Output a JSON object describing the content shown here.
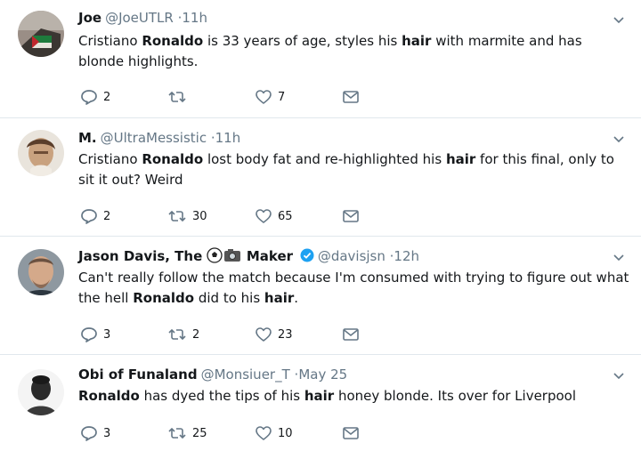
{
  "tweets": [
    {
      "name": "Joe",
      "handle": "@JoeUTLR",
      "time": "·11h",
      "text_parts": [
        {
          "t": "Cristiano ",
          "b": false
        },
        {
          "t": "Ronaldo",
          "b": true
        },
        {
          "t": " is 33 years of age, styles his ",
          "b": false
        },
        {
          "t": "hair",
          "b": true
        },
        {
          "t": " with marmite and has blonde highlights.",
          "b": false
        }
      ],
      "reply_count": "2",
      "retweet_count": "",
      "like_count": "7"
    },
    {
      "name": "M.",
      "handle": "@UltraMessistic",
      "time": "·11h",
      "text_parts": [
        {
          "t": "Cristiano ",
          "b": false
        },
        {
          "t": "Ronaldo",
          "b": true
        },
        {
          "t": " lost body fat and re-highlighted his ",
          "b": false
        },
        {
          "t": "hair",
          "b": true
        },
        {
          "t": " for this final, only to sit it out? Weird",
          "b": false
        }
      ],
      "reply_count": "2",
      "retweet_count": "30",
      "like_count": "65"
    },
    {
      "name": "Jason Davis, The",
      "name_suffix": "Maker",
      "handle": "@davisjsn",
      "time": "·12h",
      "text_parts": [
        {
          "t": "Can't really follow the match because I'm consumed with trying to figure out what the hell ",
          "b": false
        },
        {
          "t": "Ronaldo",
          "b": true
        },
        {
          "t": " did to his ",
          "b": false
        },
        {
          "t": "hair",
          "b": true
        },
        {
          "t": ".",
          "b": false
        }
      ],
      "reply_count": "3",
      "retweet_count": "2",
      "like_count": "23"
    },
    {
      "name": "Obi of Funaland",
      "handle": "@Monsiuer_T",
      "time": "·May 25",
      "text_parts": [
        {
          "t": "Ronaldo",
          "b": true
        },
        {
          "t": " has dyed the tips of his ",
          "b": false
        },
        {
          "t": "hair",
          "b": true
        },
        {
          "t": " honey blonde. Its over for Liverpool",
          "b": false
        }
      ],
      "reply_count": "3",
      "retweet_count": "25",
      "like_count": "10"
    }
  ],
  "icons": {
    "reply": "reply-icon",
    "retweet": "retweet-icon",
    "like": "heart-icon",
    "message": "envelope-icon",
    "more": "chevron-down-icon",
    "verified": "verified-badge-icon",
    "emoji": "soccer-ball-and-camera-emoji"
  },
  "colors": {
    "text": "#14171a",
    "muted": "#657786",
    "divider": "#e1e8ed",
    "verified": "#1da1f2"
  }
}
